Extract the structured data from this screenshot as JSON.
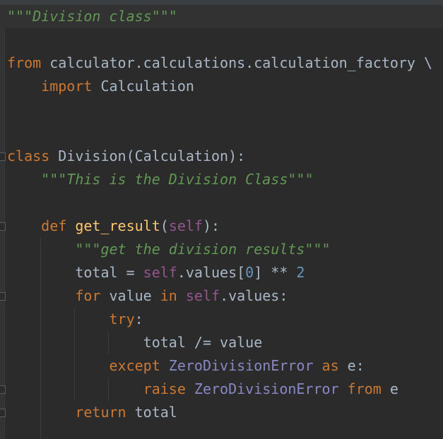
{
  "colors": {
    "background": "#2b2b2b",
    "keyword": "#cc7832",
    "string": "#629755",
    "self": "#94558d",
    "number": "#6897bb",
    "function": "#ffc66d",
    "builtin": "#8888c6",
    "text": "#a9b7c6"
  },
  "editor": {
    "current_line": 0,
    "lines": [
      [
        [
          "str",
          "\"\"\"Division class\"\"\""
        ]
      ],
      [],
      [
        [
          "kw",
          "from"
        ],
        [
          "plain",
          " calculator.calculations.calculation_factory \\"
        ]
      ],
      [
        [
          "plain",
          "    "
        ],
        [
          "kw",
          "import"
        ],
        [
          "plain",
          " Calculation"
        ]
      ],
      [],
      [],
      [
        [
          "kw",
          "class"
        ],
        [
          "plain",
          " Division(Calculation):"
        ]
      ],
      [
        [
          "plain",
          "    "
        ],
        [
          "str",
          "\"\"\"This is the Division Class\"\"\""
        ]
      ],
      [],
      [
        [
          "plain",
          "    "
        ],
        [
          "kw",
          "def"
        ],
        [
          "plain",
          " "
        ],
        [
          "fn",
          "get_result"
        ],
        [
          "plain",
          "("
        ],
        [
          "self",
          "self"
        ],
        [
          "plain",
          "):"
        ]
      ],
      [
        [
          "plain",
          "        "
        ],
        [
          "str",
          "\"\"\"get the division results\"\"\""
        ]
      ],
      [
        [
          "plain",
          "        total = "
        ],
        [
          "self",
          "self"
        ],
        [
          "plain",
          ".values["
        ],
        [
          "num",
          "0"
        ],
        [
          "plain",
          "] ** "
        ],
        [
          "num",
          "2"
        ]
      ],
      [
        [
          "plain",
          "        "
        ],
        [
          "kw",
          "for"
        ],
        [
          "plain",
          " value "
        ],
        [
          "kw",
          "in"
        ],
        [
          "plain",
          " "
        ],
        [
          "self",
          "self"
        ],
        [
          "plain",
          ".values:"
        ]
      ],
      [
        [
          "plain",
          "            "
        ],
        [
          "kw",
          "try"
        ],
        [
          "plain",
          ":"
        ]
      ],
      [
        [
          "plain",
          "                total /= value"
        ]
      ],
      [
        [
          "plain",
          "            "
        ],
        [
          "kw",
          "except"
        ],
        [
          "plain",
          " "
        ],
        [
          "builtin",
          "ZeroDivisionError"
        ],
        [
          "plain",
          " "
        ],
        [
          "kw",
          "as"
        ],
        [
          "plain",
          " e:"
        ]
      ],
      [
        [
          "plain",
          "                "
        ],
        [
          "kw",
          "raise"
        ],
        [
          "plain",
          " "
        ],
        [
          "builtin",
          "ZeroDivisionError"
        ],
        [
          "plain",
          " "
        ],
        [
          "kw",
          "from"
        ],
        [
          "plain",
          " e"
        ]
      ],
      [
        [
          "plain",
          "        "
        ],
        [
          "kw",
          "return"
        ],
        [
          "plain",
          " total"
        ]
      ]
    ]
  }
}
